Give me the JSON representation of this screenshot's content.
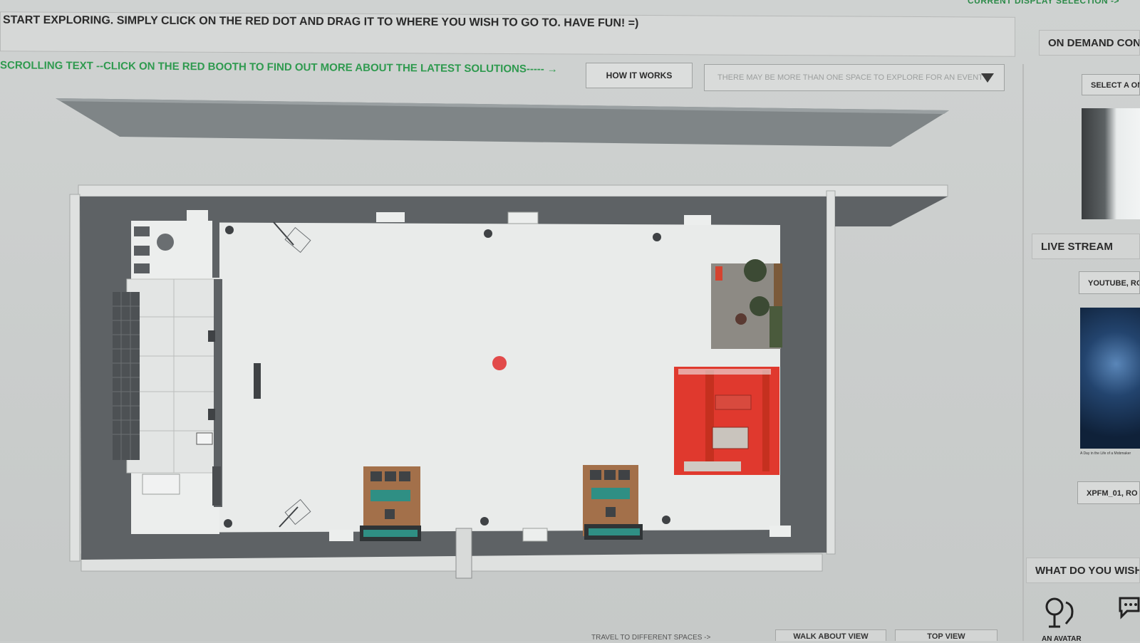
{
  "header": {
    "top_link": "CURRENT DISPLAY SELECTION ->",
    "instruction": "START EXPLORING. SIMPLY CLICK ON THE RED DOT AND DRAG IT TO WHERE YOU WISH TO GO TO. HAVE FUN! =)",
    "scrolling_text": "SCROLLING TEXT --CLICK ON THE RED BOOTH TO FIND OUT MORE ABOUT THE LATEST SOLUTIONS-----",
    "how_it_works": "HOW IT WORKS",
    "space_select_placeholder": "THERE MAY BE MORE THAN ONE SPACE TO EXPLORE FOR AN EVENT"
  },
  "sidebar": {
    "on_demand_title": "ON DEMAND CON",
    "select_button": "SELECT A ON",
    "live_stream_title": "LIVE STREAM",
    "youtube_button": "YOUTUBE, RO",
    "stream_caption": "A Day in the Life of a Mobmaker",
    "room_button": "XPFM_01, RO",
    "what_title": "WHAT DO YOU WISH"
  },
  "footer": {
    "left_note": "TRAVEL TO DIFFERENT SPACES ->",
    "walk_view": "WALK ABOUT VIEW",
    "top_view": "TOP VIEW",
    "avatar_label": "AN AVATAR"
  },
  "colors": {
    "accent_green": "#2f9a4f",
    "booth_red": "#e0392e",
    "wall_gray": "#5e6265",
    "teal": "#2f8f84"
  },
  "icons": [
    "arrow-right-icon",
    "chevron-down-icon",
    "avatar-icon",
    "chat-icon"
  ]
}
